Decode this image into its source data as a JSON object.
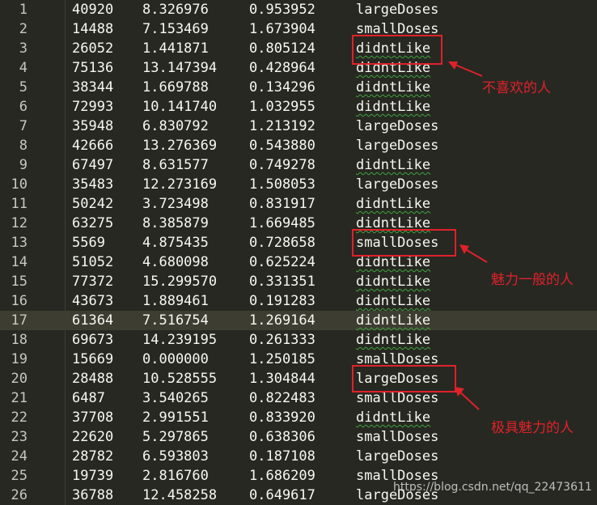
{
  "rows": [
    {
      "n": "1",
      "a": "40920",
      "b": "8.326976",
      "c": "0.953952",
      "d": "largeDoses",
      "sq": false
    },
    {
      "n": "2",
      "a": "14488",
      "b": "7.153469",
      "c": "1.673904",
      "d": "smallDoses",
      "sq": false
    },
    {
      "n": "3",
      "a": "26052",
      "b": "1.441871",
      "c": "0.805124",
      "d": "didntLike",
      "sq": true
    },
    {
      "n": "4",
      "a": "75136",
      "b": "13.147394",
      "c": "0.428964",
      "d": "didntLike",
      "sq": true
    },
    {
      "n": "5",
      "a": "38344",
      "b": "1.669788",
      "c": "0.134296",
      "d": "didntLike",
      "sq": true
    },
    {
      "n": "6",
      "a": "72993",
      "b": "10.141740",
      "c": "1.032955",
      "d": "didntLike",
      "sq": true
    },
    {
      "n": "7",
      "a": "35948",
      "b": "6.830792",
      "c": "1.213192",
      "d": "largeDoses",
      "sq": false
    },
    {
      "n": "8",
      "a": "42666",
      "b": "13.276369",
      "c": "0.543880",
      "d": "largeDoses",
      "sq": false
    },
    {
      "n": "9",
      "a": "67497",
      "b": "8.631577",
      "c": "0.749278",
      "d": "didntLike",
      "sq": true
    },
    {
      "n": "10",
      "a": "35483",
      "b": "12.273169",
      "c": "1.508053",
      "d": "largeDoses",
      "sq": false
    },
    {
      "n": "11",
      "a": "50242",
      "b": "3.723498",
      "c": "0.831917",
      "d": "didntLike",
      "sq": true
    },
    {
      "n": "12",
      "a": "63275",
      "b": "8.385879",
      "c": "1.669485",
      "d": "didntLike",
      "sq": true
    },
    {
      "n": "13",
      "a": "5569",
      "b": "4.875435",
      "c": "0.728658",
      "d": "smallDoses",
      "sq": false
    },
    {
      "n": "14",
      "a": "51052",
      "b": "4.680098",
      "c": "0.625224",
      "d": "didntLike",
      "sq": true
    },
    {
      "n": "15",
      "a": "77372",
      "b": "15.299570",
      "c": "0.331351",
      "d": "didntLike",
      "sq": true
    },
    {
      "n": "16",
      "a": "43673",
      "b": "1.889461",
      "c": "0.191283",
      "d": "didntLike",
      "sq": true
    },
    {
      "n": "17",
      "a": "61364",
      "b": "7.516754",
      "c": "1.269164",
      "d": "didntLike",
      "sq": true
    },
    {
      "n": "18",
      "a": "69673",
      "b": "14.239195",
      "c": "0.261333",
      "d": "didntLike",
      "sq": true
    },
    {
      "n": "19",
      "a": "15669",
      "b": "0.000000",
      "c": "1.250185",
      "d": "smallDoses",
      "sq": false
    },
    {
      "n": "20",
      "a": "28488",
      "b": "10.528555",
      "c": "1.304844",
      "d": "largeDoses",
      "sq": false
    },
    {
      "n": "21",
      "a": "6487",
      "b": "3.540265",
      "c": "0.822483",
      "d": "smallDoses",
      "sq": false
    },
    {
      "n": "22",
      "a": "37708",
      "b": "2.991551",
      "c": "0.833920",
      "d": "didntLike",
      "sq": true
    },
    {
      "n": "23",
      "a": "22620",
      "b": "5.297865",
      "c": "0.638306",
      "d": "smallDoses",
      "sq": false
    },
    {
      "n": "24",
      "a": "28782",
      "b": "6.593803",
      "c": "0.187108",
      "d": "largeDoses",
      "sq": false
    },
    {
      "n": "25",
      "a": "19739",
      "b": "2.816760",
      "c": "1.686209",
      "d": "smallDoses",
      "sq": false
    },
    {
      "n": "26",
      "a": "36788",
      "b": "12.458258",
      "c": "0.649617",
      "d": "largeDoses",
      "sq": false
    }
  ],
  "active_line": 17,
  "annotations": {
    "didnt_like": "不喜欢的人",
    "small_doses": "魅力一般的人",
    "large_doses": "极具魅力的人"
  },
  "watermark": "https://blog.csdn.net/qq_22473611",
  "colors": {
    "background": "#272822",
    "text": "#f8f8f2",
    "annotation_red": "#e0212a",
    "spellcheck_green": "#3fa33f",
    "active_line": "#3e3d32"
  }
}
